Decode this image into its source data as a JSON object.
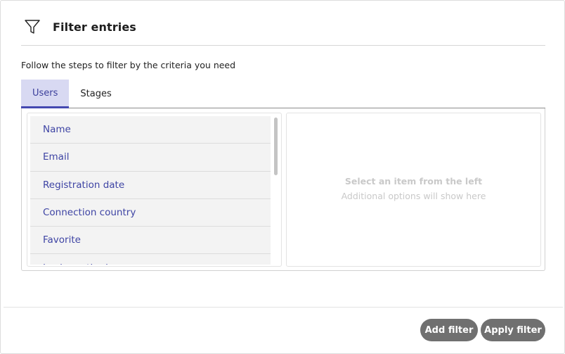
{
  "dialog": {
    "title": "Filter entries",
    "subtitle": "Follow the steps to filter by the criteria you need"
  },
  "tabs": [
    {
      "label": "Users",
      "active": true
    },
    {
      "label": "Stages",
      "active": false
    }
  ],
  "list": {
    "items": [
      {
        "label": "Name"
      },
      {
        "label": "Email"
      },
      {
        "label": "Registration date"
      },
      {
        "label": "Connection country"
      },
      {
        "label": "Favorite"
      },
      {
        "label": "Login method"
      }
    ]
  },
  "detail": {
    "title": "Select an item from the left",
    "subtitle": "Additional options will show here"
  },
  "buttons": {
    "add_label": "Add filter",
    "apply_label": "Apply filter"
  },
  "colors": {
    "accent": "#4448b0",
    "tab_active_bg": "#d8d9f2",
    "list_text": "#3e44a4",
    "button_bg": "#707070"
  },
  "icons": {
    "header": "funnel-icon"
  }
}
